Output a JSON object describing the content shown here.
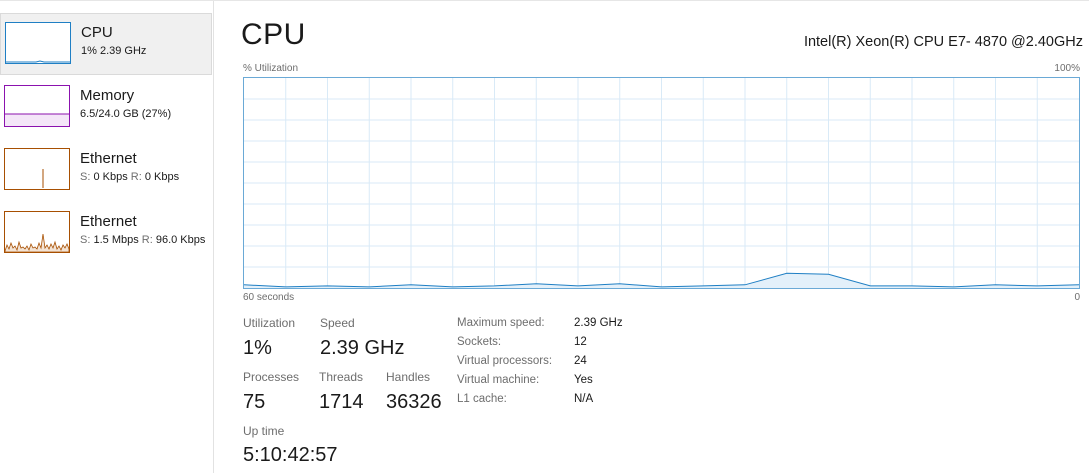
{
  "sidebar": {
    "items": [
      {
        "title": "CPU",
        "sub": "1% 2.39 GHz",
        "selected": true,
        "color": "#1f7fc4"
      },
      {
        "title": "Memory",
        "sub": "6.5/24.0 GB (27%)",
        "selected": false,
        "color": "#8b12ae"
      },
      {
        "title": "Ethernet",
        "sub_s_label": "S:",
        "sub_s_value": "0 Kbps",
        "sub_r_label": "R:",
        "sub_r_value": "0 Kbps",
        "selected": false,
        "color": "#a74f01"
      },
      {
        "title": "Ethernet",
        "sub_s_label": "S:",
        "sub_s_value": "1.5 Mbps",
        "sub_r_label": "R:",
        "sub_r_value": "96.0 Kbps",
        "selected": false,
        "color": "#a74f01"
      }
    ]
  },
  "main": {
    "title": "CPU",
    "cpu_name": "Intel(R) Xeon(R) CPU E7- 4870 @2.40GHz",
    "graph": {
      "y_label": "% Utilization",
      "y_max_label": "100%",
      "x_left_label": "60 seconds",
      "x_right_label": "0",
      "line_color": "#1f7fc4",
      "grid_color": "#d9eaf7"
    },
    "stats": {
      "utilization_label": "Utilization",
      "utilization_value": "1%",
      "speed_label": "Speed",
      "speed_value": "2.39 GHz",
      "processes_label": "Processes",
      "processes_value": "75",
      "threads_label": "Threads",
      "threads_value": "1714",
      "handles_label": "Handles",
      "handles_value": "36326",
      "uptime_label": "Up time",
      "uptime_value": "5:10:42:57"
    },
    "specs": [
      {
        "label": "Maximum speed:",
        "value": "2.39 GHz"
      },
      {
        "label": "Sockets:",
        "value": "12"
      },
      {
        "label": "Virtual processors:",
        "value": "24"
      },
      {
        "label": "Virtual machine:",
        "value": "Yes"
      },
      {
        "label": "L1 cache:",
        "value": "N/A"
      }
    ]
  },
  "chart_data": {
    "type": "line",
    "x_unit": "seconds",
    "x": [
      60,
      57,
      54,
      51,
      48,
      45,
      42,
      39,
      36,
      33,
      30,
      27,
      24,
      21,
      18,
      15,
      12,
      9,
      6,
      3,
      0
    ],
    "series": [
      {
        "values": [
          1.5,
          0.5,
          1,
          0.5,
          1.5,
          0.5,
          1,
          2,
          1,
          2,
          0.5,
          1,
          1.5,
          7,
          6.5,
          1,
          1,
          0.5,
          1.5,
          1,
          1.5
        ]
      }
    ],
    "ylim": [
      0,
      100
    ]
  }
}
